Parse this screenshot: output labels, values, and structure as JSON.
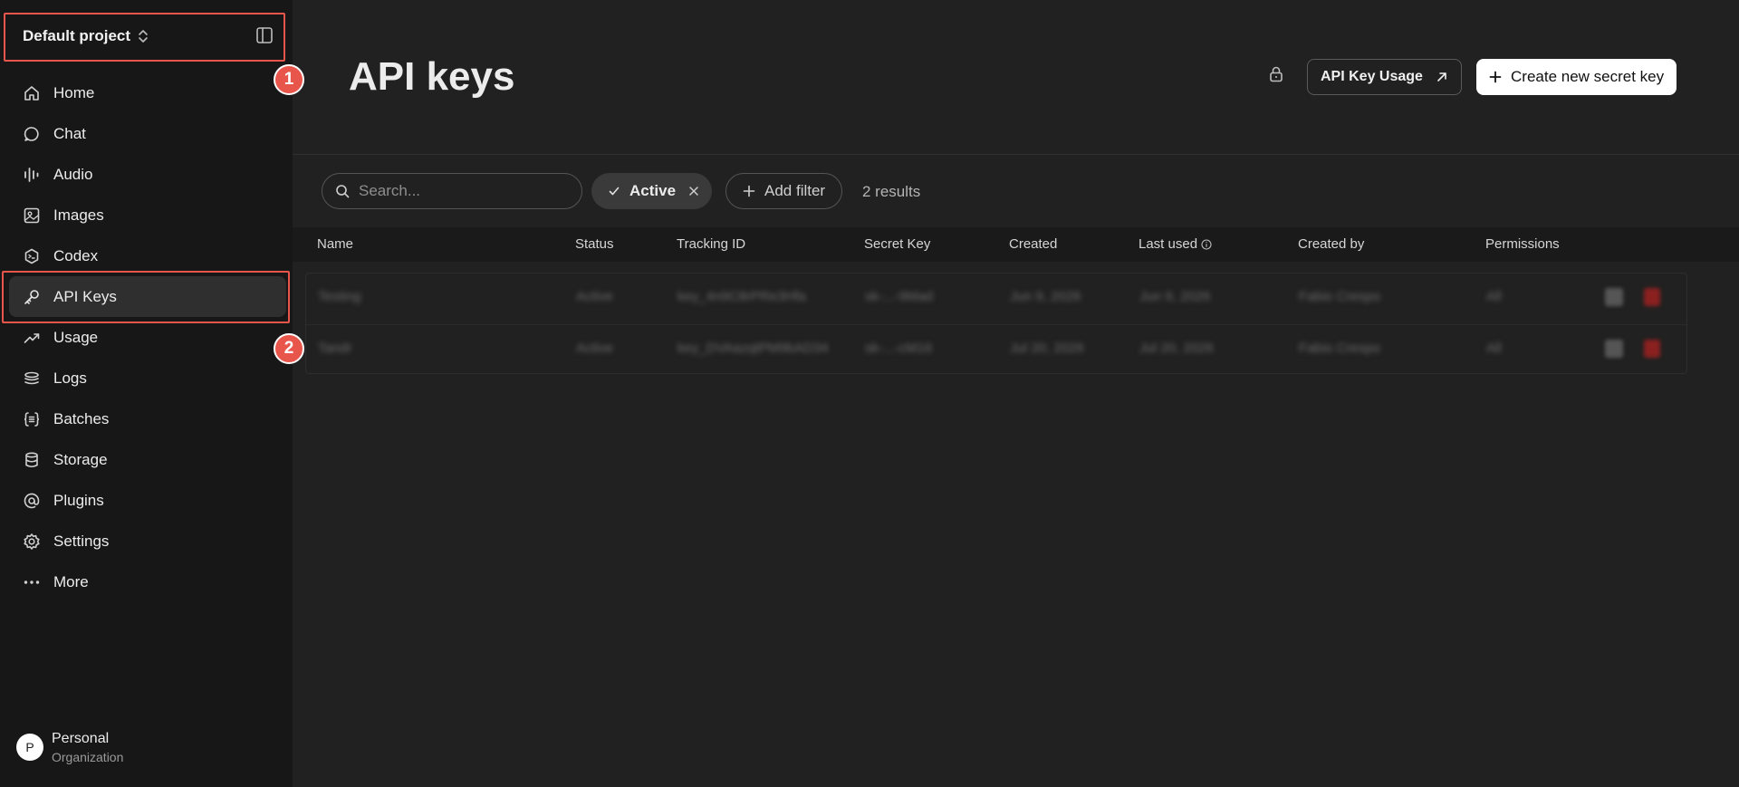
{
  "sidebar": {
    "project_name": "Default project",
    "items": [
      {
        "label": "Home",
        "icon": "home-icon"
      },
      {
        "label": "Chat",
        "icon": "chat-bubble-icon"
      },
      {
        "label": "Audio",
        "icon": "audio-wave-icon"
      },
      {
        "label": "Images",
        "icon": "image-icon"
      },
      {
        "label": "Codex",
        "icon": "codex-icon"
      },
      {
        "label": "API Keys",
        "icon": "key-icon",
        "active": true
      },
      {
        "label": "Usage",
        "icon": "trend-up-icon"
      },
      {
        "label": "Logs",
        "icon": "stack-icon"
      },
      {
        "label": "Batches",
        "icon": "braces-icon"
      },
      {
        "label": "Storage",
        "icon": "database-icon"
      },
      {
        "label": "Plugins",
        "icon": "at-sign-icon"
      },
      {
        "label": "Settings",
        "icon": "gear-icon"
      },
      {
        "label": "More",
        "icon": "more-dots-icon"
      }
    ],
    "org": {
      "initial": "P",
      "name": "Personal",
      "type": "Organization"
    }
  },
  "annotations": {
    "marker1": "1",
    "marker2": "2"
  },
  "header": {
    "title": "API keys",
    "usage_button": "API Key Usage",
    "create_button": "Create new secret key"
  },
  "filters": {
    "search_placeholder": "Search...",
    "active_chip": "Active",
    "add_filter": "Add filter",
    "results": "2 results"
  },
  "table": {
    "columns": [
      "Name",
      "Status",
      "Tracking ID",
      "Secret Key",
      "Created",
      "Last used",
      "Created by",
      "Permissions"
    ],
    "rows": [
      [
        "Testing",
        "Active",
        "key_4n9C8rPRe3Hfa",
        "sk-...-9Mad",
        "Jun 9, 2026",
        "Jun 9, 2026",
        "Fabio Crespo",
        "All"
      ],
      [
        "Tandr",
        "Active",
        "key_DVAazqtPM9bAD34",
        "sk-...-cM16",
        "Jul 20, 2026",
        "Jul 20, 2026",
        "Fabio Crespo",
        "All"
      ]
    ]
  },
  "colors": {
    "sidebar_bg": "#171717",
    "main_bg": "#212121",
    "highlight": "#e8564b",
    "delete_red": "#8a2020"
  }
}
